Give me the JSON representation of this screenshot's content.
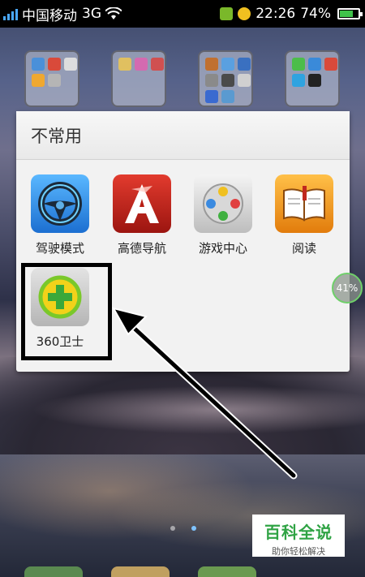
{
  "status_bar": {
    "carrier": "中国移动",
    "network": "3G",
    "time": "22:26",
    "battery_percent": "74%",
    "battery_level": 0.74
  },
  "folder": {
    "title": "不常用",
    "apps": [
      {
        "label": "驾驶模式",
        "icon": "steering-wheel-icon"
      },
      {
        "label": "高德导航",
        "icon": "gaode-navigation-icon"
      },
      {
        "label": "游戏中心",
        "icon": "gamepad-icon"
      },
      {
        "label": "阅读",
        "icon": "book-icon"
      },
      {
        "label": "360卫士",
        "icon": "360-security-icon"
      }
    ]
  },
  "floating_widget": {
    "percent": "41%"
  },
  "watermark": {
    "title": "百科全说",
    "subtitle": "助你轻松解决"
  },
  "colors": {
    "accent_green": "#2fa344",
    "signal_blue": "#4aa8ff",
    "highlight": "#000000"
  }
}
